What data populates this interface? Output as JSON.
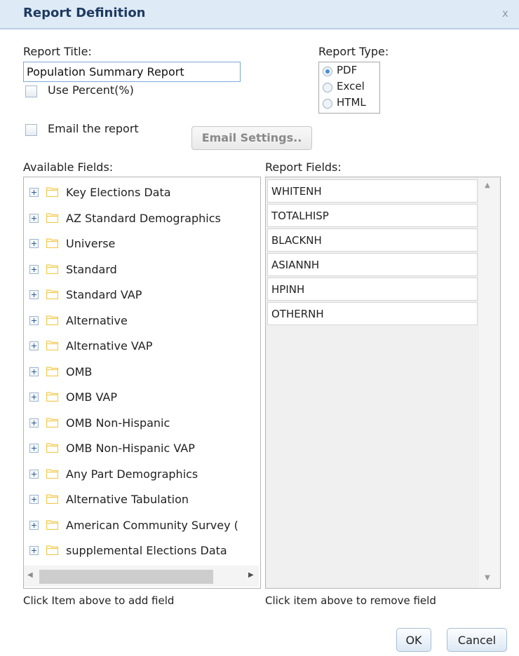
{
  "dialog": {
    "title": "Report Definition",
    "close_glyph": "x"
  },
  "report_title": {
    "label": "Report Title:",
    "value": "Population Summary Report"
  },
  "use_percent": {
    "label": "Use Percent(%)",
    "checked": false
  },
  "report_type": {
    "label": "Report Type:",
    "options": [
      "PDF",
      "Excel",
      "HTML"
    ],
    "selected": "PDF"
  },
  "email": {
    "label": "Email the report",
    "checked": false,
    "settings_button": "Email Settings.."
  },
  "available_fields": {
    "label": "Available Fields:",
    "items": [
      "Key Elections Data",
      "AZ Standard Demographics",
      "Universe",
      "Standard",
      "Standard VAP",
      "Alternative",
      "Alternative VAP",
      "OMB",
      "OMB VAP",
      "OMB Non-Hispanic",
      "OMB Non-Hispanic VAP",
      "Any Part Demographics",
      "Alternative Tabulation",
      "American Community Survey (",
      "supplemental Elections Data"
    ],
    "hint": "Click Item above to add field"
  },
  "report_fields": {
    "label": "Report Fields:",
    "items": [
      "WHITENH",
      "TOTALHISP",
      "BLACKNH",
      "ASIANNH",
      "HPINH",
      "OTHERNH"
    ],
    "hint": "Click item above to remove field"
  },
  "buttons": {
    "ok": "OK",
    "cancel": "Cancel"
  },
  "colors": {
    "titlebar_bg": "#dfeaf7",
    "title_text": "#1e3a5f",
    "folder": "#f3c94a",
    "radio_selected": "#4b8fd6"
  },
  "icons": {
    "expand": "plus-icon",
    "folder": "folder-icon"
  }
}
